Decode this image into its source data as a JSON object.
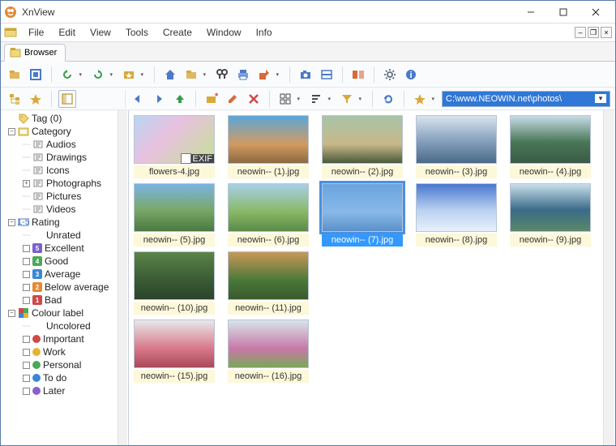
{
  "window": {
    "title": "XnView",
    "logo": "xnview-logo"
  },
  "menus": [
    "File",
    "Edit",
    "View",
    "Tools",
    "Create",
    "Window",
    "Info"
  ],
  "tab": {
    "label": "Browser",
    "icon": "browser-icon"
  },
  "address_path": "C:\\www.NEOWIN.net\\photos\\",
  "sidebar": {
    "items": [
      {
        "type": "node",
        "indent": 0,
        "toggle": "none",
        "icon": "tag",
        "label": "Tag (0)"
      },
      {
        "type": "node",
        "indent": 0,
        "toggle": "minus",
        "icon": "category",
        "label": "Category"
      },
      {
        "type": "node",
        "indent": 1,
        "toggle": "dots",
        "icon": "folder",
        "label": "Audios"
      },
      {
        "type": "node",
        "indent": 1,
        "toggle": "dots",
        "icon": "folder",
        "label": "Drawings"
      },
      {
        "type": "node",
        "indent": 1,
        "toggle": "dots",
        "icon": "folder",
        "label": "Icons"
      },
      {
        "type": "node",
        "indent": 1,
        "toggle": "plus",
        "icon": "folder",
        "label": "Photographs"
      },
      {
        "type": "node",
        "indent": 1,
        "toggle": "dots",
        "icon": "folder",
        "label": "Pictures"
      },
      {
        "type": "node",
        "indent": 1,
        "toggle": "dots",
        "icon": "folder",
        "label": "Videos"
      },
      {
        "type": "node",
        "indent": 0,
        "toggle": "minus",
        "icon": "rating",
        "label": "Rating"
      },
      {
        "type": "node",
        "indent": 1,
        "toggle": "dots",
        "icon": "none",
        "label": "Unrated"
      },
      {
        "type": "rating",
        "indent": 1,
        "badge": "5",
        "color": "#7a5fcf",
        "label": "Excellent"
      },
      {
        "type": "rating",
        "indent": 1,
        "badge": "4",
        "color": "#4aa858",
        "label": "Good"
      },
      {
        "type": "rating",
        "indent": 1,
        "badge": "3",
        "color": "#3a86d6",
        "label": "Average"
      },
      {
        "type": "rating",
        "indent": 1,
        "badge": "2",
        "color": "#e48a30",
        "label": "Below average"
      },
      {
        "type": "rating",
        "indent": 1,
        "badge": "1",
        "color": "#d04848",
        "label": "Bad"
      },
      {
        "type": "node",
        "indent": 0,
        "toggle": "minus",
        "icon": "colorlabel",
        "label": "Colour label"
      },
      {
        "type": "node",
        "indent": 1,
        "toggle": "dots",
        "icon": "none",
        "label": "Uncolored"
      },
      {
        "type": "color",
        "indent": 1,
        "color": "#d04848",
        "label": "Important"
      },
      {
        "type": "color",
        "indent": 1,
        "color": "#e4b330",
        "label": "Work"
      },
      {
        "type": "color",
        "indent": 1,
        "color": "#4aa858",
        "label": "Personal"
      },
      {
        "type": "color",
        "indent": 1,
        "color": "#3a86d6",
        "label": "To do"
      },
      {
        "type": "color",
        "indent": 1,
        "color": "#8a5fcf",
        "label": "Later"
      }
    ]
  },
  "thumbnails": {
    "rows": [
      [
        {
          "name": "flowers-4.jpg",
          "bg": "linear-gradient(135deg,#b9d6f0,#e8c0e0 40%,#c4e095)",
          "exif": true
        },
        {
          "name": "neowin-- (1).jpg",
          "bg": "linear-gradient(#5aa6d8,#d29a60 60%,#8a6a40)"
        },
        {
          "name": "neowin-- (2).jpg",
          "bg": "linear-gradient(#a8c4a8,#c8b888 60%,#4a5a3a)"
        },
        {
          "name": "neowin-- (3).jpg",
          "bg": "linear-gradient(#d8e4ec,#8aa4c0 50%,#4a6a88)"
        },
        {
          "name": "neowin-- (4).jpg",
          "bg": "linear-gradient(#c8dce8,#4a7858 55%,#3a5a44)"
        }
      ],
      [
        {
          "name": "neowin-- (5).jpg",
          "bg": "linear-gradient(#7ab4e2,#7aa868 55%,#4a7840)"
        },
        {
          "name": "neowin-- (6).jpg",
          "bg": "linear-gradient(#a8d0e8,#88b862 60%,#5a8a48)"
        },
        {
          "name": "neowin-- (7).jpg",
          "bg": "linear-gradient(#6aa4e0,#88b8e8 60%,#5a90c8)",
          "selected": true
        },
        {
          "name": "neowin-- (8).jpg",
          "bg": "linear-gradient(#4a78d0,#b8d0f0 55%,#e8f0fa)"
        },
        {
          "name": "neowin-- (9).jpg",
          "bg": "linear-gradient(#c8e0ea,#3a6a88 55%,#5a8868)"
        }
      ],
      [
        {
          "name": "neowin-- (10).jpg",
          "bg": "linear-gradient(#5a8448,#3a5a34 60%,#2a4428)"
        },
        {
          "name": "neowin-- (11).jpg",
          "bg": "linear-gradient(#c89858,#4a7838 60%,#3a5a2c)"
        }
      ],
      [
        {
          "name": "neowin-- (15).jpg",
          "bg": "linear-gradient(#e8e8e8,#d8788a 60%,#a84858)"
        },
        {
          "name": "neowin-- (16).jpg",
          "bg": "linear-gradient(#d8e4e8,#c878a8 60%,#7aa858)"
        }
      ]
    ]
  },
  "toolbar1_icons": [
    {
      "name": "open-icon",
      "color": "#d8a83a"
    },
    {
      "name": "fullscreen-icon",
      "color": "#4a7ac8"
    },
    {
      "name": "sep"
    },
    {
      "name": "rotate-ccw-icon",
      "color": "#3a9a48",
      "dd": true
    },
    {
      "name": "rotate-cw-icon",
      "color": "#3a9a48",
      "dd": true
    },
    {
      "name": "favorites-icon",
      "color": "#d8a83a",
      "dd": true
    },
    {
      "name": "sep"
    },
    {
      "name": "home-icon",
      "color": "#4a7ac8"
    },
    {
      "name": "folder-open-icon",
      "color": "#d8a83a",
      "dd": true
    },
    {
      "name": "search-icon",
      "color": "#4a4a4a"
    },
    {
      "name": "print-icon",
      "color": "#4a7ac8"
    },
    {
      "name": "export-icon",
      "color": "#d86a3a",
      "dd": true
    },
    {
      "name": "sep"
    },
    {
      "name": "camera-icon",
      "color": "#4a7ac8"
    },
    {
      "name": "scan-icon",
      "color": "#4a7ac8"
    },
    {
      "name": "sep"
    },
    {
      "name": "compare-icon",
      "color": "#d86a3a"
    },
    {
      "name": "sep"
    },
    {
      "name": "settings-icon",
      "color": "#6a7a8a"
    },
    {
      "name": "info-icon",
      "color": "#4a7ac8"
    }
  ],
  "toolbar2_left_icons": [
    {
      "name": "tree-icon",
      "color": "#d8a83a"
    },
    {
      "name": "favorites-tree-icon",
      "color": "#d8a83a"
    },
    {
      "name": "sep"
    },
    {
      "name": "categories-panel-icon",
      "color": "#c8a850",
      "active": true
    }
  ],
  "toolbar2_right_icons": [
    {
      "name": "back-icon",
      "color": "#4a7ac8"
    },
    {
      "name": "forward-icon",
      "color": "#4a7ac8"
    },
    {
      "name": "up-icon",
      "color": "#3a9a48"
    },
    {
      "name": "sep"
    },
    {
      "name": "new-folder-icon",
      "color": "#d8a83a"
    },
    {
      "name": "edit-icon",
      "color": "#d86a3a"
    },
    {
      "name": "delete-icon",
      "color": "#d04848"
    },
    {
      "name": "sep"
    },
    {
      "name": "view-mode-icon",
      "color": "#4a4a4a",
      "dd": true
    },
    {
      "name": "sort-icon",
      "color": "#4a4a4a",
      "dd": true
    },
    {
      "name": "filter-icon",
      "color": "#d8a83a",
      "dd": true
    },
    {
      "name": "sep"
    },
    {
      "name": "refresh-icon",
      "color": "#4a7ac8"
    },
    {
      "name": "sep"
    },
    {
      "name": "star-icon",
      "color": "#d8a83a",
      "dd": true
    }
  ]
}
